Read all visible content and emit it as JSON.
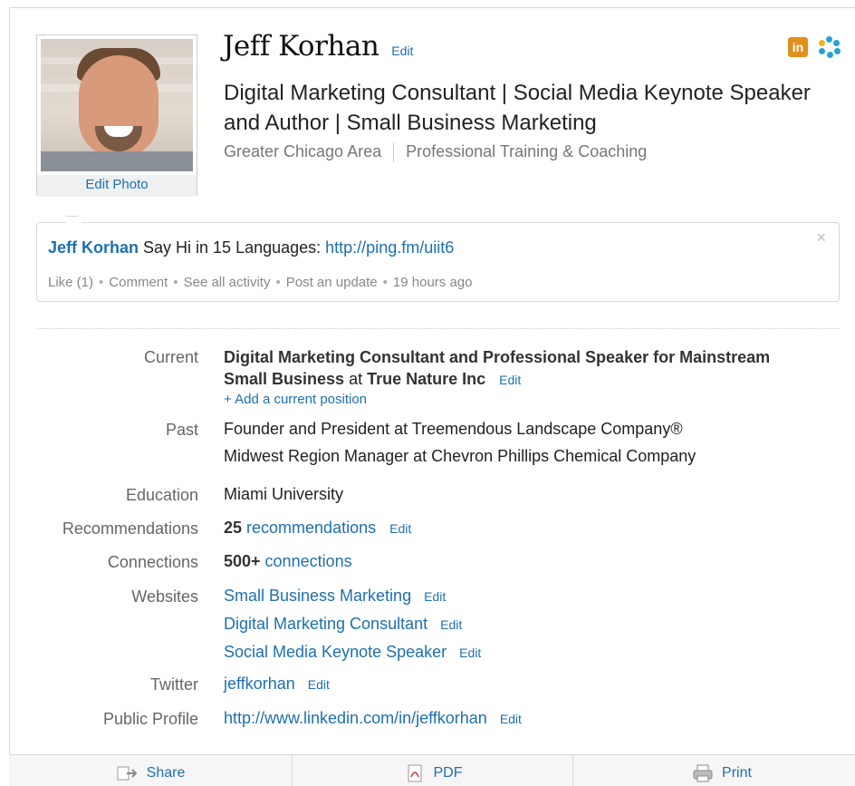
{
  "profile": {
    "name": "Jeff Korhan",
    "name_edit": "Edit",
    "headline": "Digital Marketing Consultant | Social Media Keynote Speaker and Author | Small Business Marketing",
    "location": "Greater Chicago Area",
    "industry": "Professional Training & Coaching",
    "edit_photo": "Edit Photo"
  },
  "icons": {
    "linkedin_badge": "linkedin-icon",
    "network_ring": "ring-icon",
    "badge_text": "in",
    "badge_color": "#e0901c"
  },
  "status": {
    "author": "Jeff Korhan",
    "text": " Say Hi in 15 Languages: ",
    "link": "http://ping.fm/uiit6",
    "actions": [
      "Like (1)",
      "Comment",
      "See all activity",
      "Post an update",
      "19 hours ago"
    ],
    "close": "×"
  },
  "overview": {
    "current": {
      "label": "Current",
      "title_bold": "Digital Marketing Consultant and Professional Speaker for Mainstream Small Business",
      "at": " at ",
      "company": "True Nature Inc",
      "edit": "Edit",
      "add": "+ Add a current position"
    },
    "past": {
      "label": "Past",
      "items": [
        "Founder and President at Treemendous Landscape Company®",
        "Midwest Region Manager at Chevron Phillips Chemical Company"
      ]
    },
    "education": {
      "label": "Education",
      "value": "Miami University"
    },
    "recommendations": {
      "label": "Recommendations",
      "count": "25",
      "text": " recommendations",
      "edit": "Edit"
    },
    "connections": {
      "label": "Connections",
      "count": "500+",
      "text": " connections"
    },
    "websites": {
      "label": "Websites",
      "items": [
        "Small Business Marketing",
        "Digital Marketing Consultant",
        "Social Media Keynote Speaker"
      ],
      "edit": "Edit"
    },
    "twitter": {
      "label": "Twitter",
      "handle": "jeffkorhan",
      "edit": "Edit"
    },
    "public_profile": {
      "label": "Public Profile",
      "url": "http://www.linkedin.com/in/jeffkorhan",
      "edit": "Edit"
    }
  },
  "footer": {
    "share": "Share",
    "pdf": "PDF",
    "print": "Print"
  },
  "colors": {
    "link": "#1f6fae",
    "accent_orange": "#e0901c"
  }
}
